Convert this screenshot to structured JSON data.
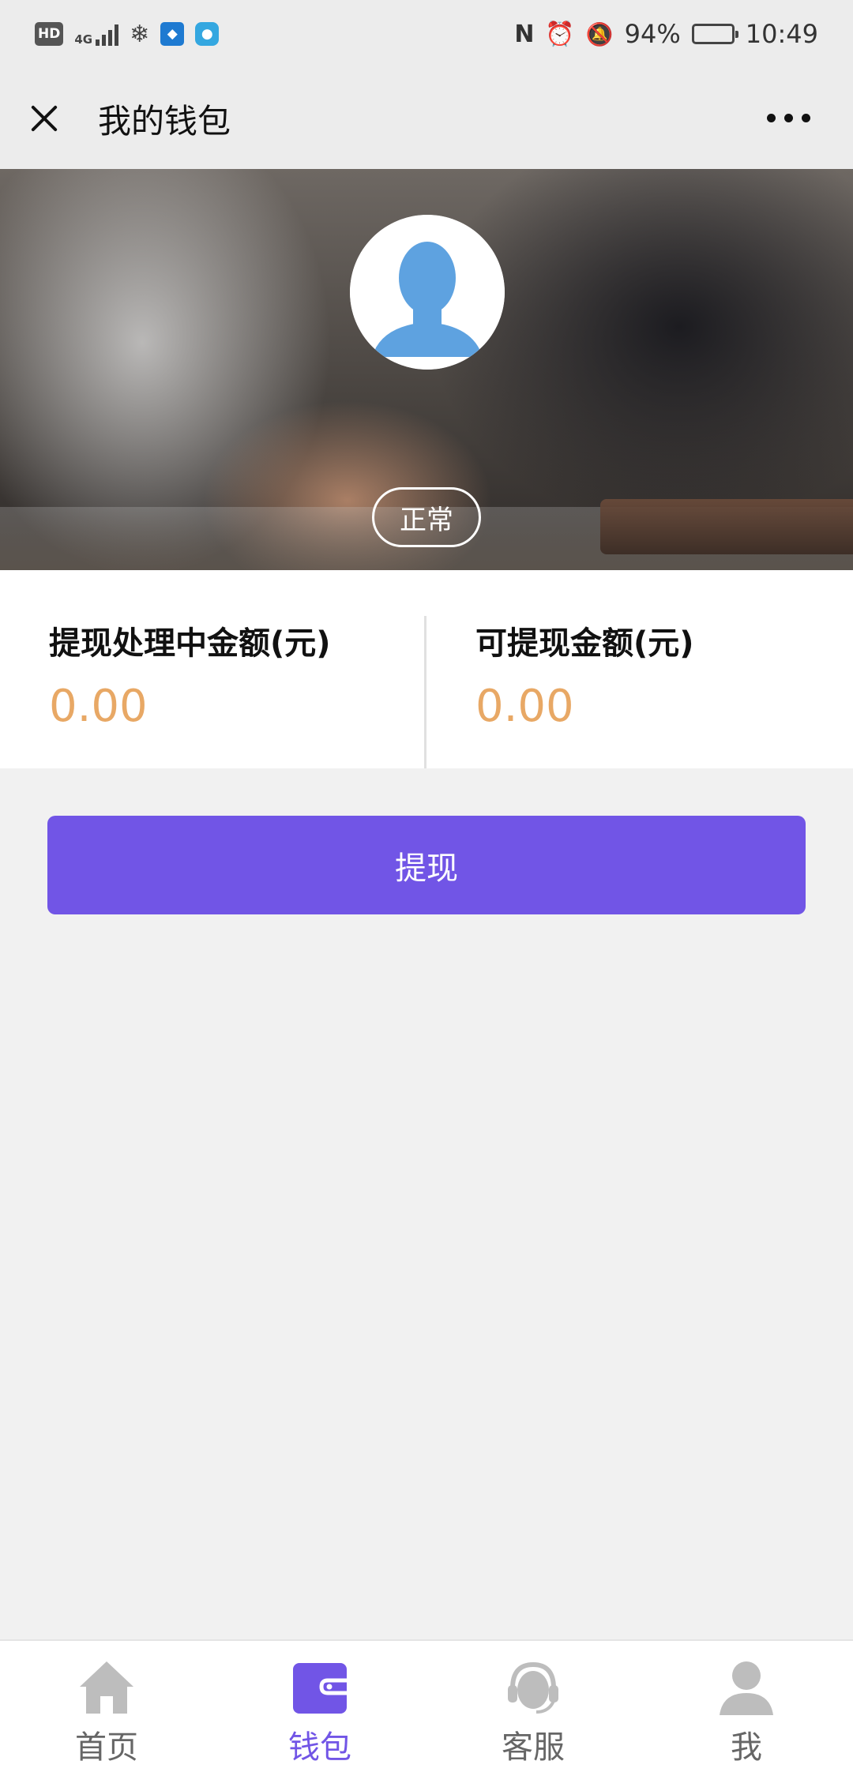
{
  "status_bar": {
    "hd_label": "HD",
    "network_label": "4G",
    "battery_percent": "94%",
    "battery_level": 0.94,
    "time": "10:49",
    "icons": [
      "hd-icon",
      "signal-icon",
      "app-icon",
      "shield-icon",
      "browser-icon",
      "nfc-icon",
      "alarm-icon",
      "mute-icon",
      "battery-icon"
    ]
  },
  "nav": {
    "title": "我的钱包",
    "close_icon": "close-icon",
    "more_icon": "more-icon"
  },
  "hero": {
    "avatar_icon": "default-avatar-icon",
    "status": "正常"
  },
  "balances": {
    "processing_label": "提现处理中金额(元)",
    "processing_value": "0.00",
    "available_label": "可提现金额(元)",
    "available_value": "0.00",
    "value_color": "#e8a865"
  },
  "actions": {
    "withdraw_label": "提现",
    "accent_color": "#7155e6"
  },
  "tabs": [
    {
      "label": "首页",
      "icon": "home-icon",
      "active": false
    },
    {
      "label": "钱包",
      "icon": "wallet-icon",
      "active": true
    },
    {
      "label": "客服",
      "icon": "customer-service-icon",
      "active": false
    },
    {
      "label": "我",
      "icon": "user-icon",
      "active": false
    }
  ]
}
